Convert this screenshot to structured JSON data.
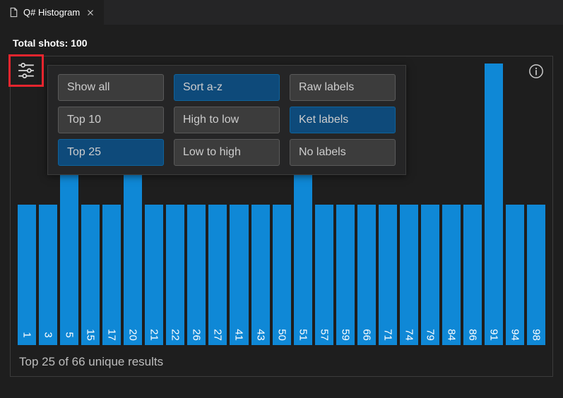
{
  "tab": {
    "title": "Q# Histogram"
  },
  "header": {
    "total_shots": "Total shots: 100"
  },
  "options": {
    "filter": [
      {
        "label": "Show all",
        "selected": false
      },
      {
        "label": "Top 10",
        "selected": false
      },
      {
        "label": "Top 25",
        "selected": true
      }
    ],
    "sort": [
      {
        "label": "Sort a-z",
        "selected": true
      },
      {
        "label": "High to low",
        "selected": false
      },
      {
        "label": "Low to high",
        "selected": false
      }
    ],
    "labels": [
      {
        "label": "Raw labels",
        "selected": false
      },
      {
        "label": "Ket labels",
        "selected": true
      },
      {
        "label": "No labels",
        "selected": false
      }
    ]
  },
  "footer": "Top 25 of 66 unique results",
  "chart_data": {
    "type": "bar",
    "title": "Q# Histogram",
    "xlabel": "",
    "ylabel": "",
    "ylim": [
      0,
      4
    ],
    "categories": [
      "1",
      "3",
      "5",
      "15",
      "17",
      "20",
      "21",
      "22",
      "26",
      "27",
      "41",
      "43",
      "50",
      "51",
      "57",
      "59",
      "66",
      "71",
      "74",
      "79",
      "84",
      "86",
      "91",
      "94",
      "98"
    ],
    "values": [
      2,
      2,
      3,
      2,
      2,
      3,
      2,
      2,
      2,
      2,
      2,
      2,
      2,
      3,
      2,
      2,
      2,
      2,
      2,
      2,
      2,
      2,
      4,
      2,
      2
    ]
  },
  "colors": {
    "bar": "#0f88d6",
    "bg": "#1e1e1e",
    "highlight": "#e8252e"
  }
}
